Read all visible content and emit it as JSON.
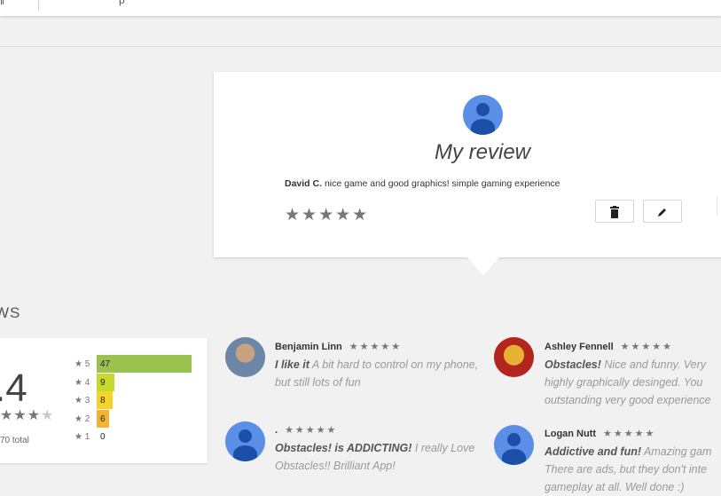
{
  "topbar": {
    "left_glyph": "ǁ",
    "mid_glyph": "p"
  },
  "my_review": {
    "title": "My review",
    "author": "David C.",
    "text": "nice game and good graphics! simple gaming experience",
    "stars": "★★★★★",
    "delete_icon": "trash-icon",
    "edit_icon": "pencil-icon"
  },
  "reviews": {
    "heading": "WS",
    "rating": ".4",
    "stars": "★★★",
    "half_star": "★",
    "total": "70 total",
    "histogram": [
      {
        "label": "★ 5",
        "count": "47",
        "value": 47,
        "color": "#9bc24f"
      },
      {
        "label": "★ 4",
        "count": "9",
        "value": 9,
        "color": "#c7d92e"
      },
      {
        "label": "★ 3",
        "count": "8",
        "value": 8,
        "color": "#f5d32a"
      },
      {
        "label": "★ 2",
        "count": "6",
        "value": 6,
        "color": "#f6b233"
      },
      {
        "label": "★ 1",
        "count": "0",
        "value": 0,
        "color": "#f08a3c"
      }
    ],
    "items": [
      {
        "name": "Benjamin Linn",
        "stars": "★★★★★",
        "headline": "I like it",
        "body": "A bit hard to control on my phone, but still lots of fun"
      },
      {
        "name": "Ashley Fennell",
        "stars": "★★★★★",
        "headline": "Obstacles!",
        "body": "Nice and funny. Very highly graphically desinged. You outstanding very good experience"
      },
      {
        "name": ".",
        "stars": "★★★★★",
        "headline": "Obstacles! is ADDICTING!",
        "body": "I really Love Obstacles!! Brilliant App!"
      },
      {
        "name": "Logan Nutt",
        "stars": "★★★★★",
        "headline": "Addictive and fun!",
        "body": "Amazing gam There are ads, but they don't inte gameplay at all. Well done :)"
      }
    ]
  }
}
